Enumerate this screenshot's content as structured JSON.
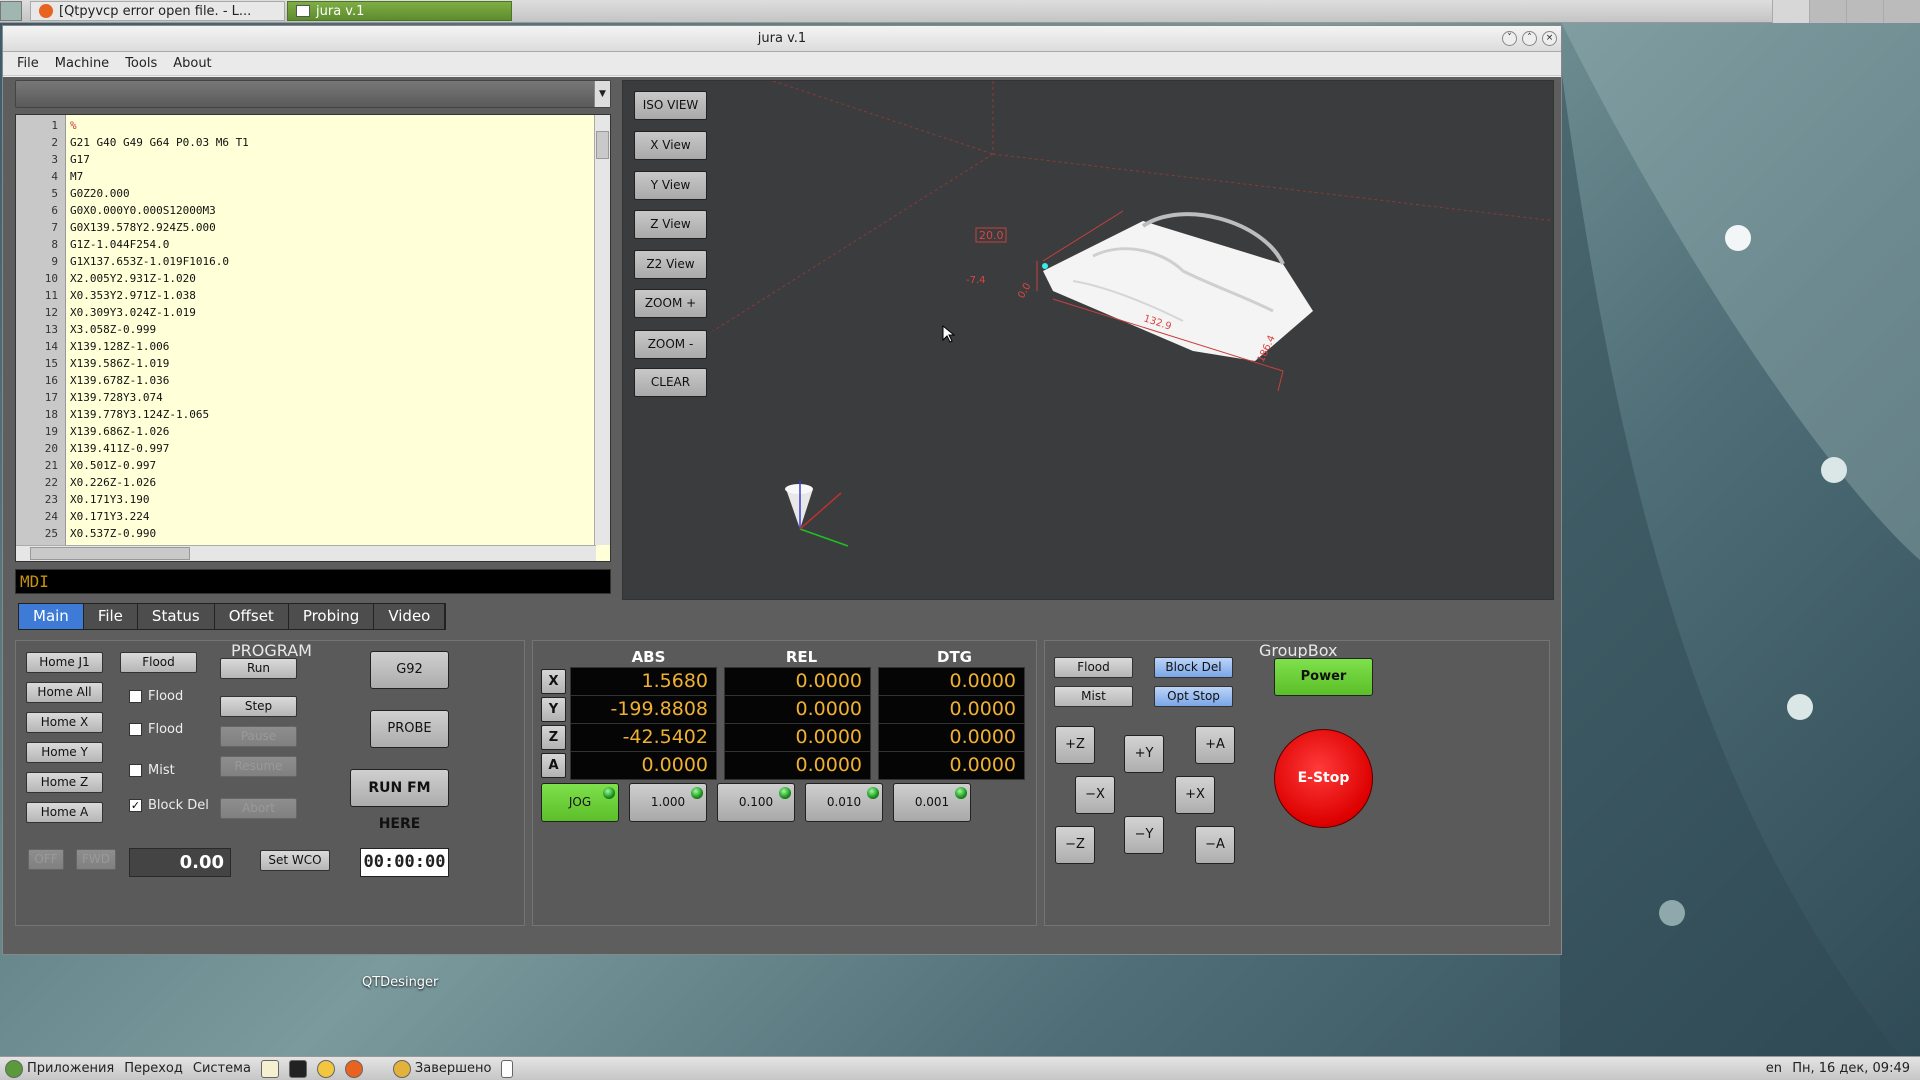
{
  "taskbar_top": {
    "task1": "[Qtpyvcp error open file. - L...",
    "task2": "jura v.1"
  },
  "desktop": {
    "icon_label": "QTDesinger"
  },
  "taskbar_bottom": {
    "apps": "Приложения",
    "places": "Переход",
    "system": "Система",
    "finished_task": "Завершено",
    "lang": "en",
    "clock": "Пн, 16 дек, 09:49"
  },
  "window": {
    "title": "jura v.1",
    "menu": [
      "File",
      "Machine",
      "Tools",
      "About"
    ]
  },
  "editor": {
    "lines": [
      {
        "n": "1",
        "t": "%"
      },
      {
        "n": "2",
        "t": "G21 G40 G49 G64 P0.03 M6 T1"
      },
      {
        "n": "3",
        "t": "G17"
      },
      {
        "n": "4",
        "t": "M7"
      },
      {
        "n": "5",
        "t": "G0Z20.000"
      },
      {
        "n": "6",
        "t": "G0X0.000Y0.000S12000M3"
      },
      {
        "n": "7",
        "t": "G0X139.578Y2.924Z5.000"
      },
      {
        "n": "8",
        "t": "G1Z-1.044F254.0"
      },
      {
        "n": "9",
        "t": "G1X137.653Z-1.019F1016.0"
      },
      {
        "n": "10",
        "t": "X2.005Y2.931Z-1.020"
      },
      {
        "n": "11",
        "t": "X0.353Y2.971Z-1.038"
      },
      {
        "n": "12",
        "t": "X0.309Y3.024Z-1.019"
      },
      {
        "n": "13",
        "t": "X3.058Z-0.999"
      },
      {
        "n": "14",
        "t": "X139.128Z-1.006"
      },
      {
        "n": "15",
        "t": "X139.586Z-1.019"
      },
      {
        "n": "16",
        "t": "X139.678Z-1.036"
      },
      {
        "n": "17",
        "t": "X139.728Y3.074"
      },
      {
        "n": "18",
        "t": "X139.778Y3.124Z-1.065"
      },
      {
        "n": "19",
        "t": "X139.686Z-1.026"
      },
      {
        "n": "20",
        "t": "X139.411Z-0.997"
      },
      {
        "n": "21",
        "t": "X0.501Z-0.997"
      },
      {
        "n": "22",
        "t": "X0.226Z-1.026"
      },
      {
        "n": "23",
        "t": "X0.171Y3.190"
      },
      {
        "n": "24",
        "t": "X0.171Y3.224"
      },
      {
        "n": "25",
        "t": "X0.537Z-0.990"
      }
    ]
  },
  "mdi": {
    "label": "MDI"
  },
  "viewer": {
    "buttons": [
      "ISO VIEW",
      "X View",
      "Y View",
      "Z View",
      "Z2 View",
      "ZOOM +",
      "ZOOM -",
      "CLEAR"
    ],
    "dims": {
      "height": "20.0",
      "depth": "-7.4",
      "width": "132.9",
      "zero": "0.0",
      "yval": "186.4"
    }
  },
  "tabs": [
    "Main",
    "File",
    "Status",
    "Offset",
    "Probing",
    "Video"
  ],
  "program": {
    "title": "PROGRAM",
    "home_buttons": [
      "Home J1",
      "Home All",
      "Home X",
      "Home Y",
      "Home Z",
      "Home A"
    ],
    "flood_btn": "Flood",
    "checks": [
      {
        "label": "Flood",
        "checked": false
      },
      {
        "label": "Flood",
        "checked": false
      },
      {
        "label": "Mist",
        "checked": false
      },
      {
        "label": "Block Del",
        "checked": true
      }
    ],
    "run_buttons": [
      "Run",
      "Step",
      "Pause",
      "Resume",
      "Abort"
    ],
    "g92": "G92",
    "probe": "PROBE",
    "run_from_here": "RUN FM HERE",
    "off": "OFF",
    "fwd": "FWD",
    "spindle": "0.00",
    "set_wco": "Set WCO",
    "timer": "00:00:00"
  },
  "dro": {
    "headers": [
      "ABS",
      "REL",
      "DTG"
    ],
    "rows": [
      {
        "axis": "X",
        "abs": "1.5680",
        "rel": "0.0000",
        "dtg": "0.0000"
      },
      {
        "axis": "Y",
        "abs": "-199.8808",
        "rel": "0.0000",
        "dtg": "0.0000"
      },
      {
        "axis": "Z",
        "abs": "-42.5402",
        "rel": "0.0000",
        "dtg": "0.0000"
      },
      {
        "axis": "A",
        "abs": "0.0000",
        "rel": "0.0000",
        "dtg": "0.0000"
      }
    ],
    "jog": [
      "JOG",
      "1.000",
      "0.100",
      "0.010",
      "0.001"
    ]
  },
  "groupbox": {
    "title": "GroupBox",
    "flood": "Flood",
    "mist": "Mist",
    "block_del": "Block Del",
    "opt_stop": "Opt Stop",
    "power": "Power",
    "estop": "E-Stop",
    "jog": [
      "+Z",
      "+Y",
      "+A",
      "−X",
      "+X",
      "−Z",
      "−Y",
      "−A"
    ]
  },
  "colors": {
    "accent": "#3d7bd6",
    "dro_text": "#f0b030",
    "power": "#6fcf3a",
    "estop": "#e01818"
  }
}
